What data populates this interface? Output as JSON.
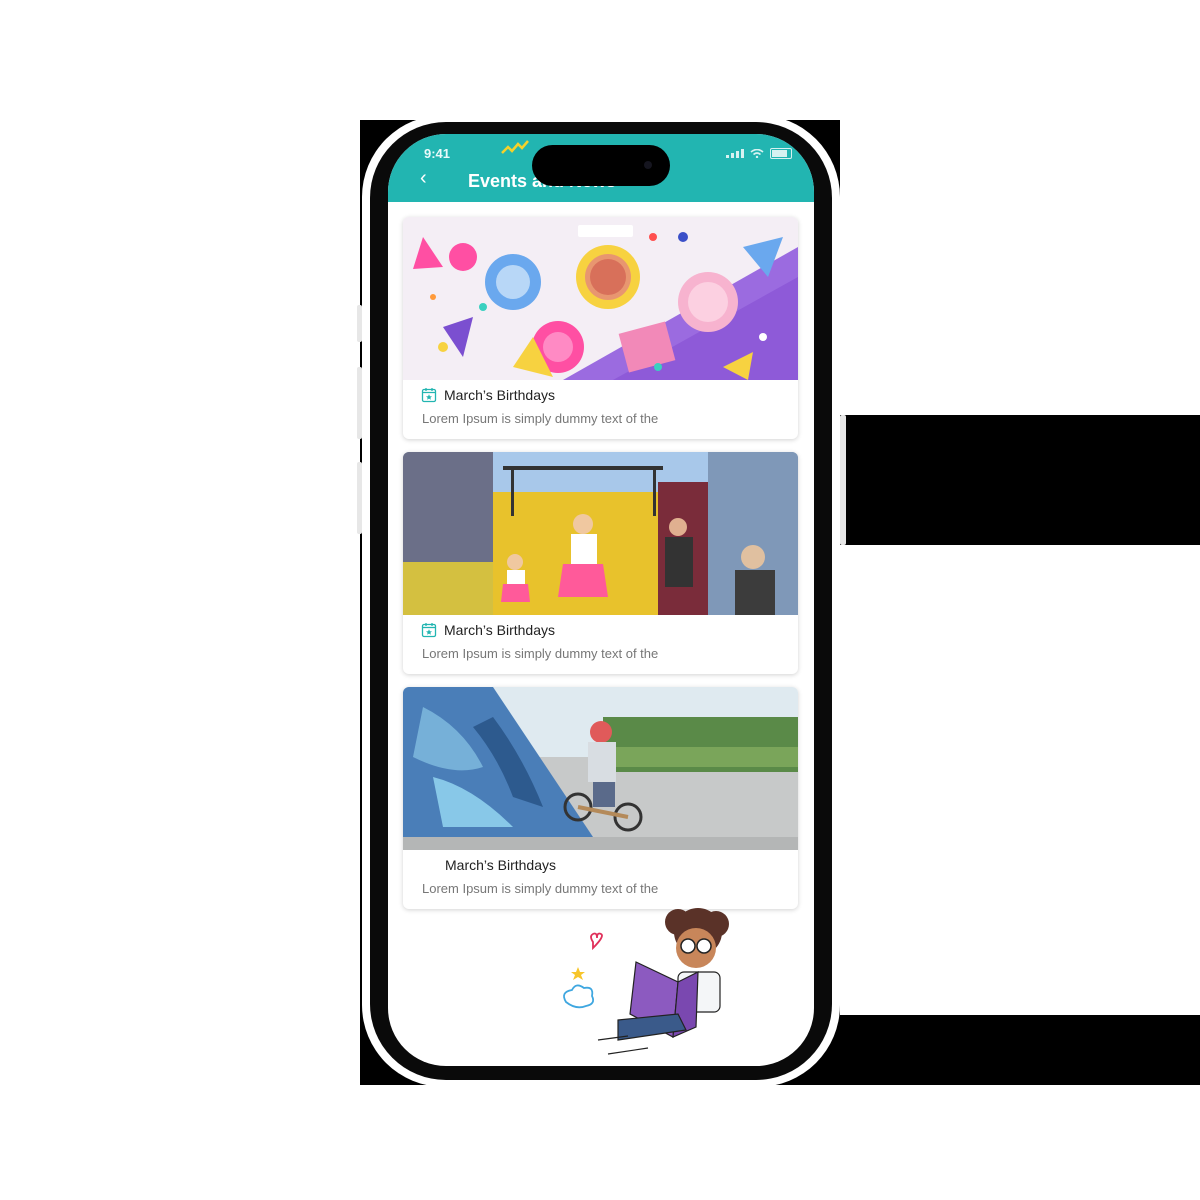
{
  "status_bar": {
    "time": "9:41"
  },
  "header": {
    "back_icon": "chevron-left-icon",
    "title": "Events and News"
  },
  "colors": {
    "accent": "#22b5b1",
    "icon": "#22b5b1"
  },
  "events": [
    {
      "title": "March’s Birthdays",
      "description": "Lorem Ipsum is simply dummy text of the",
      "icon": "calendar-star-icon",
      "image": "party-table-photo"
    },
    {
      "title": "March’s Birthdays",
      "description": "Lorem Ipsum is simply dummy text of the",
      "icon": "calendar-star-icon",
      "image": "kids-parade-photo"
    },
    {
      "title": "March’s Birthdays",
      "description": "Lorem Ipsum is simply dummy text of the",
      "icon": "",
      "image": "skatepark-balance-bike-photo"
    }
  ],
  "illustration": "child-reading-book-illustration"
}
